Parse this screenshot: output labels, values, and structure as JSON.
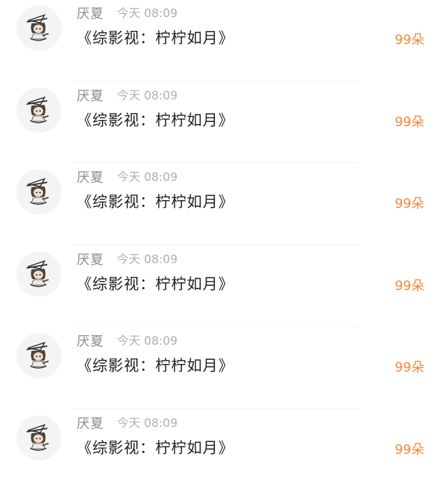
{
  "rows": [
    {
      "username": "厌夏",
      "time": "今天 08:09",
      "title": "《综影视：柠柠如月》",
      "flowers": "99朵"
    },
    {
      "username": "厌夏",
      "time": "今天 08:09",
      "title": "《综影视：柠柠如月》",
      "flowers": "99朵"
    },
    {
      "username": "厌夏",
      "time": "今天 08:09",
      "title": "《综影视：柠柠如月》",
      "flowers": "99朵"
    },
    {
      "username": "厌夏",
      "time": "今天 08:09",
      "title": "《综影视：柠柠如月》",
      "flowers": "99朵"
    },
    {
      "username": "厌夏",
      "time": "今天 08:09",
      "title": "《综影视：柠柠如月》",
      "flowers": "99朵"
    },
    {
      "username": "厌夏",
      "time": "今天 08:09",
      "title": "《综影视：柠柠如月》",
      "flowers": "99朵"
    }
  ],
  "colors": {
    "accent": "#f5873a",
    "username": "#8c8c8c",
    "time": "#b0b0b0",
    "title": "#222222",
    "divider": "#f0f0f0"
  },
  "icons": {
    "avatar": "avatar-witch-chibi-icon"
  }
}
